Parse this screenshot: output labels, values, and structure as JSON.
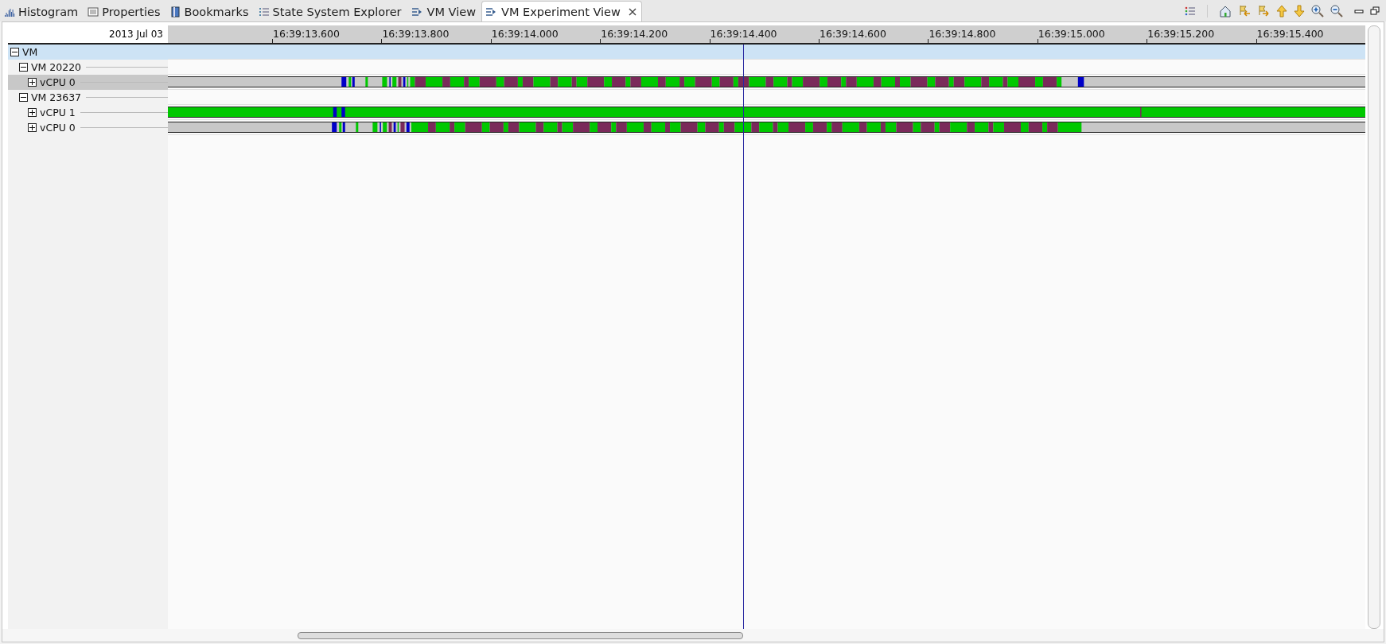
{
  "tabs": [
    {
      "label": "Histogram",
      "selected": false,
      "kind": "histogram"
    },
    {
      "label": "Properties",
      "selected": false,
      "kind": "properties"
    },
    {
      "label": "Bookmarks",
      "selected": false,
      "kind": "bookmarks"
    },
    {
      "label": "State System Explorer",
      "selected": false,
      "kind": "list"
    },
    {
      "label": "VM View",
      "selected": false,
      "kind": "view"
    },
    {
      "label": "VM Experiment View",
      "selected": true,
      "kind": "view"
    }
  ],
  "time_ruler": {
    "date": "2013 Jul 03",
    "ticks": [
      "16:39:13.600",
      "16:39:13.800",
      "16:39:14.000",
      "16:39:14.200",
      "16:39:14.400",
      "16:39:14.600",
      "16:39:14.800",
      "16:39:15.000",
      "16:39:15.200",
      "16:39:15.400"
    ]
  },
  "tree": [
    {
      "label": "VM",
      "expanded": true,
      "selected": true,
      "highlighted": false,
      "children": [
        {
          "label": "VM 20220",
          "expanded": true,
          "selected": false,
          "highlighted": false,
          "children": [
            {
              "label": "vCPU 0",
              "expanded": false,
              "selected": false,
              "highlighted": true,
              "kind": "cpu"
            }
          ]
        },
        {
          "label": "VM 23637",
          "expanded": true,
          "selected": false,
          "highlighted": false,
          "children": [
            {
              "label": "vCPU 1",
              "expanded": false,
              "selected": false,
              "highlighted": false,
              "kind": "cpu-busy"
            },
            {
              "label": "vCPU 0",
              "expanded": false,
              "selected": false,
              "highlighted": false,
              "kind": "cpu"
            }
          ]
        }
      ]
    }
  ]
}
